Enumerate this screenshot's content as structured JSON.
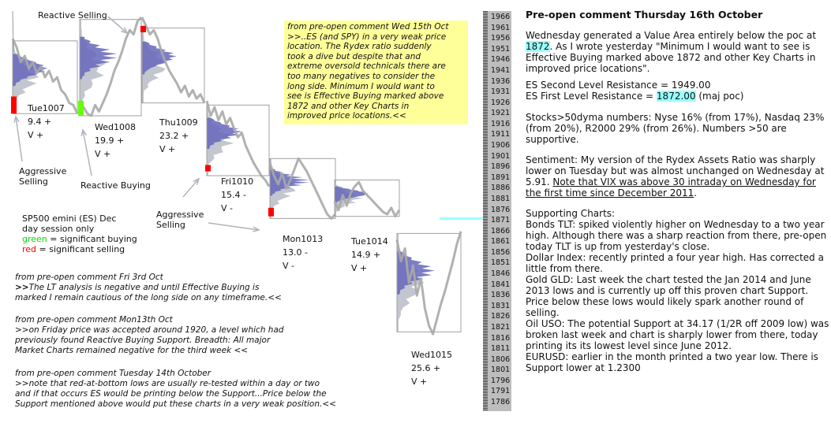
{
  "chart_data": {
    "type": "line",
    "title": "SP500 emini (ES) Dec day session only",
    "subtitle_lines": [
      "SP500 emini  (ES)  Dec",
      "day session only"
    ],
    "legend": [
      {
        "label": "green",
        "text": " = significant buying",
        "color": "#00ff00"
      },
      {
        "label": "red",
        "text": " = significant selling",
        "color": "#ff0000"
      }
    ],
    "ylabel": "",
    "y_ticks": [
      1966,
      1961,
      1956,
      1951,
      1946,
      1941,
      1936,
      1931,
      1926,
      1921,
      1916,
      1911,
      1906,
      1901,
      1896,
      1891,
      1886,
      1881,
      1876,
      1871,
      1866,
      1861,
      1856,
      1851,
      1846,
      1841,
      1836,
      1831,
      1826,
      1821,
      1816,
      1811,
      1806,
      1801,
      1796,
      1791,
      1786
    ],
    "ylim": [
      1783,
      1969
    ],
    "reference_line": {
      "value": 1872,
      "color": "#99ffff",
      "label": "poc 1872"
    },
    "sessions": [
      {
        "name": "Tue1007",
        "score": "9.4 +",
        "volume": "V +",
        "box": [
          1921,
          1955
        ],
        "price": [
          1956,
          1952,
          1945,
          1948,
          1942,
          1945,
          1940,
          1943,
          1938,
          1941,
          1936,
          1938,
          1932,
          1930,
          1926,
          1925,
          1921
        ],
        "signal": {
          "color": "red",
          "range": [
            1921,
            1929
          ]
        }
      },
      {
        "name": "Wed1008",
        "score": "19.9 +",
        "volume": "V +",
        "box": [
          1920,
          1965
        ],
        "price": [
          1926,
          1924,
          1921,
          1920,
          1925,
          1922,
          1926,
          1930,
          1935,
          1941,
          1945,
          1950,
          1956,
          1960,
          1958,
          1964,
          1966
        ],
        "signal": {
          "color": "green",
          "range": [
            1920,
            1927
          ]
        }
      },
      {
        "name": "Thu1009",
        "score": "23.2 +",
        "volume": "V +",
        "box": [
          1926,
          1961
        ],
        "price": [
          1966,
          1962,
          1958,
          1960,
          1956,
          1950,
          1945,
          1941,
          1938,
          1935,
          1931,
          1934,
          1929,
          1932,
          1928,
          1930,
          1926
        ],
        "signal": {
          "color": "red",
          "range": [
            1959,
            1962
          ]
        }
      },
      {
        "name": "Fri1010",
        "score": "15.4 -",
        "volume": "V -",
        "box": [
          1892,
          1925
        ],
        "price": [
          1927,
          1920,
          1924,
          1918,
          1922,
          1916,
          1919,
          1914,
          1910,
          1912,
          1906,
          1902,
          1898,
          1895,
          1892,
          1890,
          1887
        ],
        "signal": {
          "color": "red",
          "range": [
            1894,
            1897
          ]
        }
      },
      {
        "name": "Mon1013",
        "score": "13.0 -",
        "volume": "V -",
        "box": [
          1872,
          1900
        ],
        "price": [
          1898,
          1892,
          1888,
          1893,
          1886,
          1890,
          1895,
          1900,
          1897,
          1894,
          1890,
          1886,
          1882,
          1878,
          1874,
          1872,
          1874
        ],
        "signal": {
          "color": "red",
          "range": [
            1873,
            1877
          ]
        }
      },
      {
        "name": "Tue1014",
        "score": "14.9 +",
        "volume": "V +",
        "box": [
          1873,
          1890
        ],
        "price": [
          1880,
          1876,
          1883,
          1878,
          1884,
          1887,
          1889,
          1885,
          1883,
          1881,
          1879,
          1877,
          1875,
          1874,
          1877,
          1873,
          1876
        ],
        "signal": null
      },
      {
        "name": "Wed1015",
        "score": "25.6 +",
        "volume": "V +",
        "box": [
          1819,
          1865
        ],
        "price": [
          1862,
          1852,
          1858,
          1842,
          1850,
          1836,
          1844,
          1830,
          1822,
          1818,
          1825,
          1832,
          1838,
          1845,
          1852,
          1860,
          1866
        ],
        "signal": null
      }
    ],
    "annotations": [
      {
        "text": "Reactive Selling"
      },
      {
        "text": "Aggressive Selling"
      },
      {
        "text": "Reactive Buying"
      },
      {
        "text": "Aggressive Selling"
      }
    ]
  },
  "notes": {
    "yellow": [
      "from pre-open comment Wed 15th Oct",
      ">>..ES (and SPY) in a very weak price",
      "location. The Rydex ratio suddenly",
      "took a dive but despite that and",
      "extreme oversold technicals there are",
      "too many negatives to consider the",
      "long side. Minimum I would want to",
      "see is Effective Buying marked above",
      "1872 and other Key Charts in",
      "improved price locations.<<"
    ],
    "fri3": {
      "head": "from pre-open comment Fri 3rd Oct",
      "marker": ">>",
      "line1": "The LT analysis is negative and until Effective Buying is",
      "line2": "marked I remain cautious of the long side on any timeframe.<<"
    },
    "mon13": [
      "from pre-open comment Mon13th Oct",
      ">>on Friday price was accepted around 1920, a level which had",
      "previously found Reactive Buying Support.   Breadth: All major",
      "Market Charts remained negative for the third week <<"
    ],
    "tue14": [
      "from pre-open comment Tuesday 14th October",
      ">>note that red-at-bottom lows are usually re-tested within a day or two",
      "and if that occurs ES would be printing below the Support...Price below the",
      "Support mentioned above would put these charts in a very weak position.<<"
    ]
  },
  "commentary": {
    "title": "Pre-open comment Thursday 16th October",
    "p1_a": "Wednesday generated a Value Area entirely below the poc at ",
    "p1_hl": "1872",
    "p1_b": ".  As I wrote yesterday \"Minimum I would want to see is Effective Buying marked above 1872 and other Key Charts in improved price locations\".",
    "res2": "ES Second Level Resistance = 1949.00",
    "res1_a": "ES First Level Resistance = ",
    "res1_hl": "1872.00",
    "res1_b": " (maj poc)",
    "breadth": "Stocks>50dyma numbers: Nyse 16% (from 17%), Nasdaq 23% (from 20%), R2000 29% (from 26%). Numbers >50 are supportive.",
    "sent_a": "Sentiment: My version of the Rydex Assets Ratio was sharply lower on Tuesday but was almost unchanged on Wednesday at 5.91.  ",
    "sent_u": "Note that VIX was above 30 intraday on Wednesday for the first time since December 2011",
    "sent_b": ".",
    "supporting": [
      "Supporting Charts:",
      "Bonds TLT: spiked violently higher on Wednesday to a two year high.  Although there was a sharp reaction from there, pre-open today TLT is up from yesterday's close.",
      "Dollar Index: recently printed a four year high. Has corrected a little from there.",
      "Gold GLD: Last week the chart tested the Jan 2014 and June 2013 lows and is currently up off this proven chart Support.  Price below these lows would likely spark another round of selling.",
      "Oil USO: The potential Support at 34.17 (1/2R off 2009 low) was broken last week and chart is sharply lower from there, today printing its its lowest level since June 2012.",
      "EURUSD: earlier in the month printed a two year low. There is Support lower at 1.2300"
    ]
  },
  "colors": {
    "profile": "#6666bb",
    "profile_outer": "#b8bcc6",
    "price": "#a8a8a8",
    "box": "#a0a0a0",
    "highlight": "#99ffff",
    "note_bg": "#ffff99"
  }
}
